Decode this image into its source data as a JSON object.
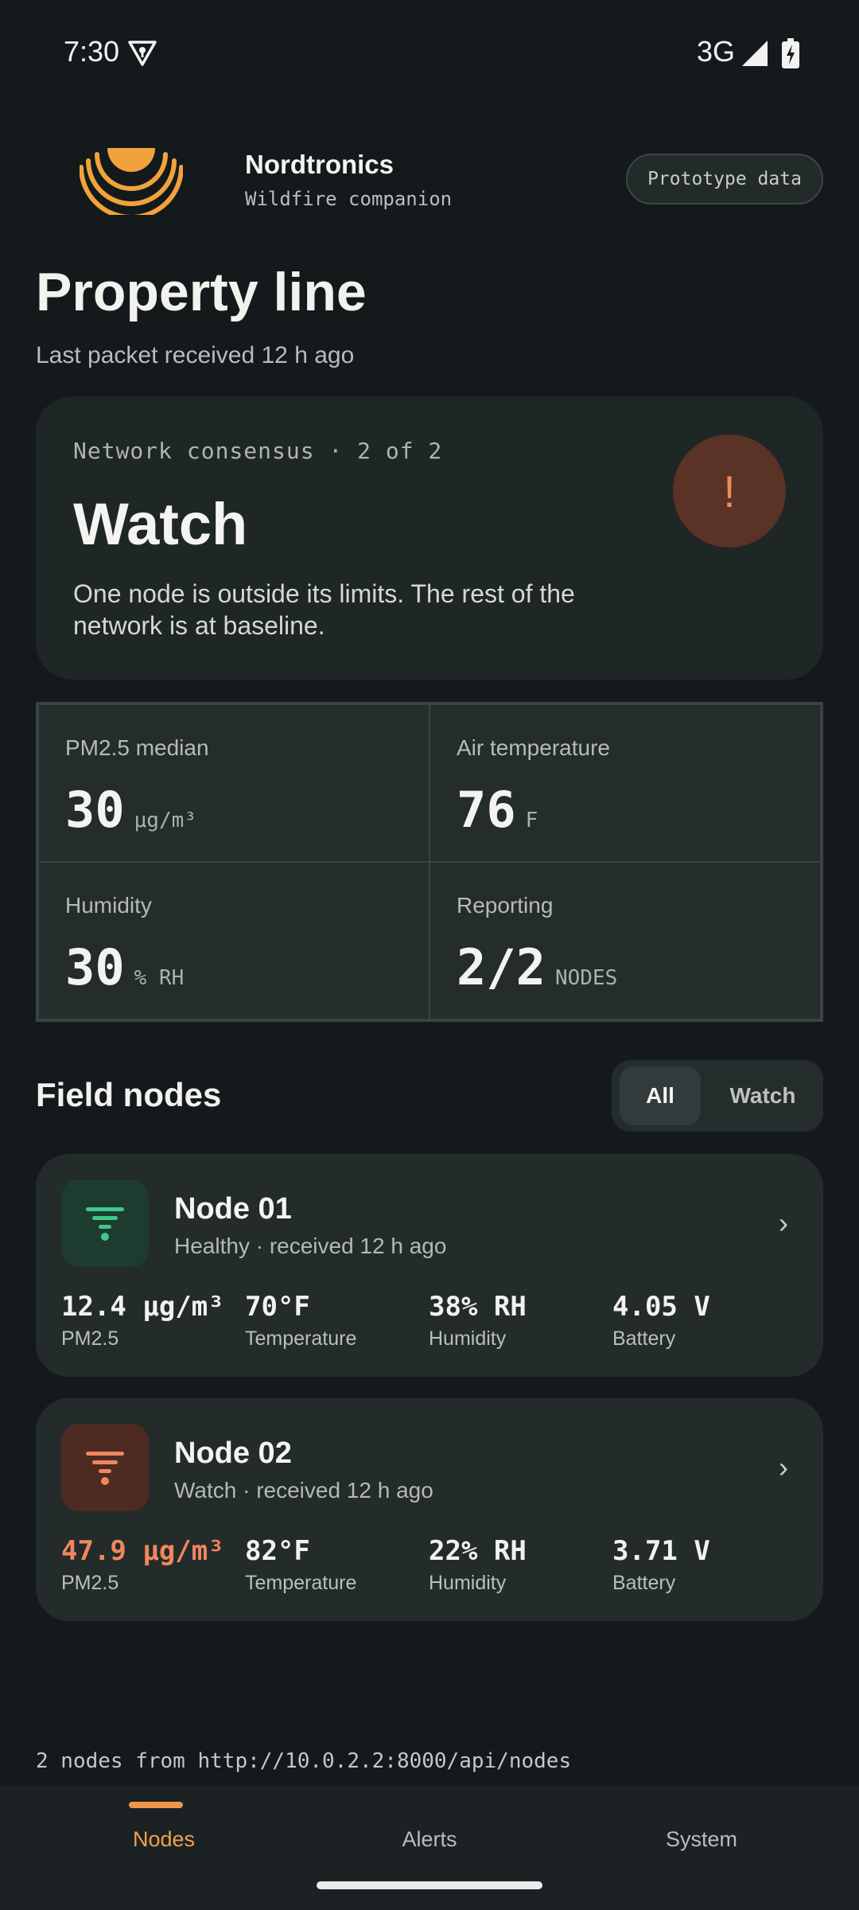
{
  "status_bar": {
    "time": "7:30",
    "network": "3G"
  },
  "brand": {
    "name": "Nordtronics",
    "subtitle": "Wildfire companion",
    "badge": "Prototype data"
  },
  "page": {
    "title": "Property line",
    "subtitle": "Last packet received 12 h ago"
  },
  "consensus": {
    "label": "Network consensus · 2 of 2",
    "status": "Watch",
    "description": "One node is outside its limits. The rest of the network is at baseline.",
    "badge_symbol": "!"
  },
  "metrics": [
    {
      "label": "PM2.5 median",
      "value": "30",
      "unit": "μg/m³"
    },
    {
      "label": "Air temperature",
      "value": "76",
      "unit": "F"
    },
    {
      "label": "Humidity",
      "value": "30",
      "unit": "% RH"
    },
    {
      "label": "Reporting",
      "value": "2/2",
      "unit": "NODES"
    }
  ],
  "field_nodes": {
    "title": "Field nodes",
    "filters": [
      "All",
      "Watch"
    ],
    "selected_filter": "All"
  },
  "nodes": [
    {
      "name": "Node 01",
      "status": "Healthy · received 12 h ago",
      "readings": [
        {
          "value": "12.4 μg/m³",
          "label": "PM2.5"
        },
        {
          "value": "70°F",
          "label": "Temperature"
        },
        {
          "value": "38% RH",
          "label": "Humidity"
        },
        {
          "value": "4.05 V",
          "label": "Battery"
        }
      ]
    },
    {
      "name": "Node 02",
      "status": "Watch · received 12 h ago",
      "readings": [
        {
          "value": "47.9 μg/m³",
          "label": "PM2.5"
        },
        {
          "value": "82°F",
          "label": "Temperature"
        },
        {
          "value": "22% RH",
          "label": "Humidity"
        },
        {
          "value": "3.71 V",
          "label": "Battery"
        }
      ]
    }
  ],
  "footer": {
    "source": "2 nodes from http://10.0.2.2:8000/api/nodes"
  },
  "nav": {
    "items": [
      "Nodes",
      "Alerts",
      "System"
    ],
    "active": "Nodes"
  },
  "colors": {
    "background": "#141a1b",
    "accent": "#f0964c",
    "healthy": "#3ec98a",
    "watch": "#f0875c"
  },
  "icons": {
    "vpn": "vpn-key-icon",
    "signal": "cell-signal-icon",
    "battery": "battery-charging-icon",
    "logo": "sun-rays-logo",
    "node": "sensor-filter-icon",
    "chevron": "chevron-right-icon",
    "alert": "exclamation-icon"
  }
}
